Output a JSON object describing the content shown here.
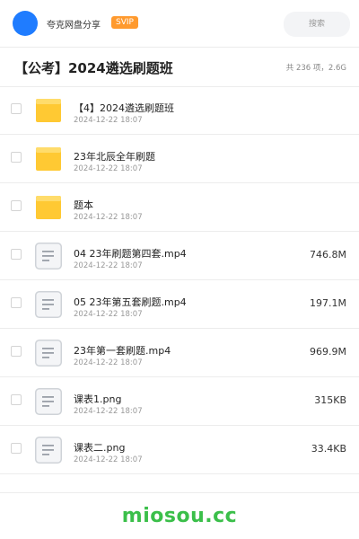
{
  "header": {
    "username": "夸克网盘分享",
    "badge": "SVIP",
    "search_placeholder": "搜索",
    "accent_color": "#1f7cff",
    "badge_color": "#ff9a2e"
  },
  "folder": {
    "title": "【公考】2024遴选刷题班",
    "summary": "共 236 项，2.6G"
  },
  "items": [
    {
      "name": "【4】2024遴选刷题班",
      "date": "2024-12-22 18:07",
      "size": "",
      "icon": "folder-icon"
    },
    {
      "name": "23年北辰全年刷题",
      "date": "2024-12-22 18:07",
      "size": "",
      "icon": "folder-icon"
    },
    {
      "name": "题本",
      "date": "2024-12-22 18:07",
      "size": "",
      "icon": "folder-icon"
    },
    {
      "name": "04  23年刷题第四套.mp4",
      "date": "2024-12-22 18:07",
      "size": "746.8M",
      "icon": "file-icon"
    },
    {
      "name": "05  23年第五套刷题.mp4",
      "date": "2024-12-22 18:07",
      "size": "197.1M",
      "icon": "file-icon"
    },
    {
      "name": "23年第一套刷题.mp4",
      "date": "2024-12-22 18:07",
      "size": "969.9M",
      "icon": "file-icon"
    },
    {
      "name": "课表1.png",
      "date": "2024-12-22 18:07",
      "size": "315KB",
      "icon": "file-icon"
    },
    {
      "name": "课表二.png",
      "date": "2024-12-22 18:07",
      "size": "33.4KB",
      "icon": "file-icon"
    }
  ],
  "watermark": "miosou.cc"
}
